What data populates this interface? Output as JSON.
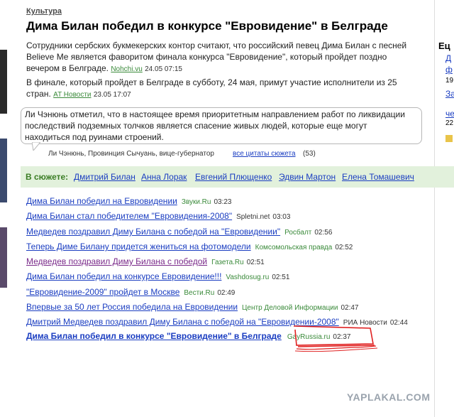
{
  "article": {
    "category": "Культура",
    "headline": "Дима Билан победил в конкурсе \"Евровидение\" в Белграде",
    "para1": {
      "line1": "Сотрудники сербских букмекерских контор считают, что российский певец Дима Билан с песней",
      "line2": "Believe Me является фаворитом финала конкурса \"Евровидение\", который пройдет поздно",
      "line3": "вечером в Белграде.",
      "source": "Nohchi.vu",
      "time": "24.05 07:15"
    },
    "para2": {
      "line1": "В финале, который пройдет в Белграде в субботу, 24 мая, примут участие исполнители из 25",
      "line2": "стран.",
      "source": "AT Новости",
      "time": "23.05 17:07"
    }
  },
  "quote": {
    "line1": "Ли Чэнюнь отметил, что в настоящее время приоритетным направлением работ по ликвидации",
    "line2": "последствий подземных толчков является спасение живых людей, которые еще могут",
    "line3": "находиться под руинами строений.",
    "author": "Ли Чэнюнь, Провинция Сычуань, вице-губернатор",
    "all_link": "все цитаты сюжета",
    "count": "(53)"
  },
  "story": {
    "label": "В сюжете:",
    "people": [
      "Дмитрий Билан",
      "Анна Лорак",
      "Евгений Плющенко",
      "Эдвин Мартон",
      "Елена Томашевич"
    ]
  },
  "news": [
    {
      "title": "Дима Билан победил на Евровидении",
      "source": "Звуки.Ru",
      "time": "03:23"
    },
    {
      "title": "Дима Билан стал победителем \"Евровидения-2008\"",
      "source": "Spletni.net",
      "time": "03:03"
    },
    {
      "title": "Медведев поздравил Диму Билана с победой на \"Евровидении\"",
      "source": "Росбалт",
      "time": "02:56"
    },
    {
      "title": "Теперь Диме Билану придется жениться на фотомодели",
      "source": "Комсомольская правда",
      "time": "02:52"
    },
    {
      "title": "Медведев поздравил Диму Билана с победой",
      "source": "Газета.Ru",
      "time": "02:51"
    },
    {
      "title": "Дима Билан победил на конкурсе Евровидение!!!",
      "source": "Vashdosug.ru",
      "time": "02:51"
    },
    {
      "title": "\"Евровидение-2009\" пройдет в Москве",
      "source": "Вести.Ru",
      "time": "02:49"
    },
    {
      "title": "Впервые за 50 лет Россия победила на Евровидении",
      "source": "Центр Деловой Информации",
      "time": "02:47"
    },
    {
      "title": "Дмитрий Медведев поздравил Диму Билана с победой на \"Евровидении-2008\"",
      "source": "РИА Новости",
      "time": "02:44"
    },
    {
      "title": "Дима Билан победил в конкурсе \"Евровидение\" в Белграде",
      "source": "GayRussia.ru",
      "time": "02:37"
    }
  ],
  "right_column": {
    "title": "Ец",
    "lines": [
      "Д",
      "ф",
      "19",
      "За",
      "че",
      "22"
    ]
  },
  "watermark": "YAPLAKAL.COM",
  "colors": {
    "link": "#1a3dc1",
    "visited": "#7a2a8a",
    "source_green": "#3a8a3a",
    "story_bar": "#e2f1dc",
    "story_label": "#3a7d24"
  }
}
